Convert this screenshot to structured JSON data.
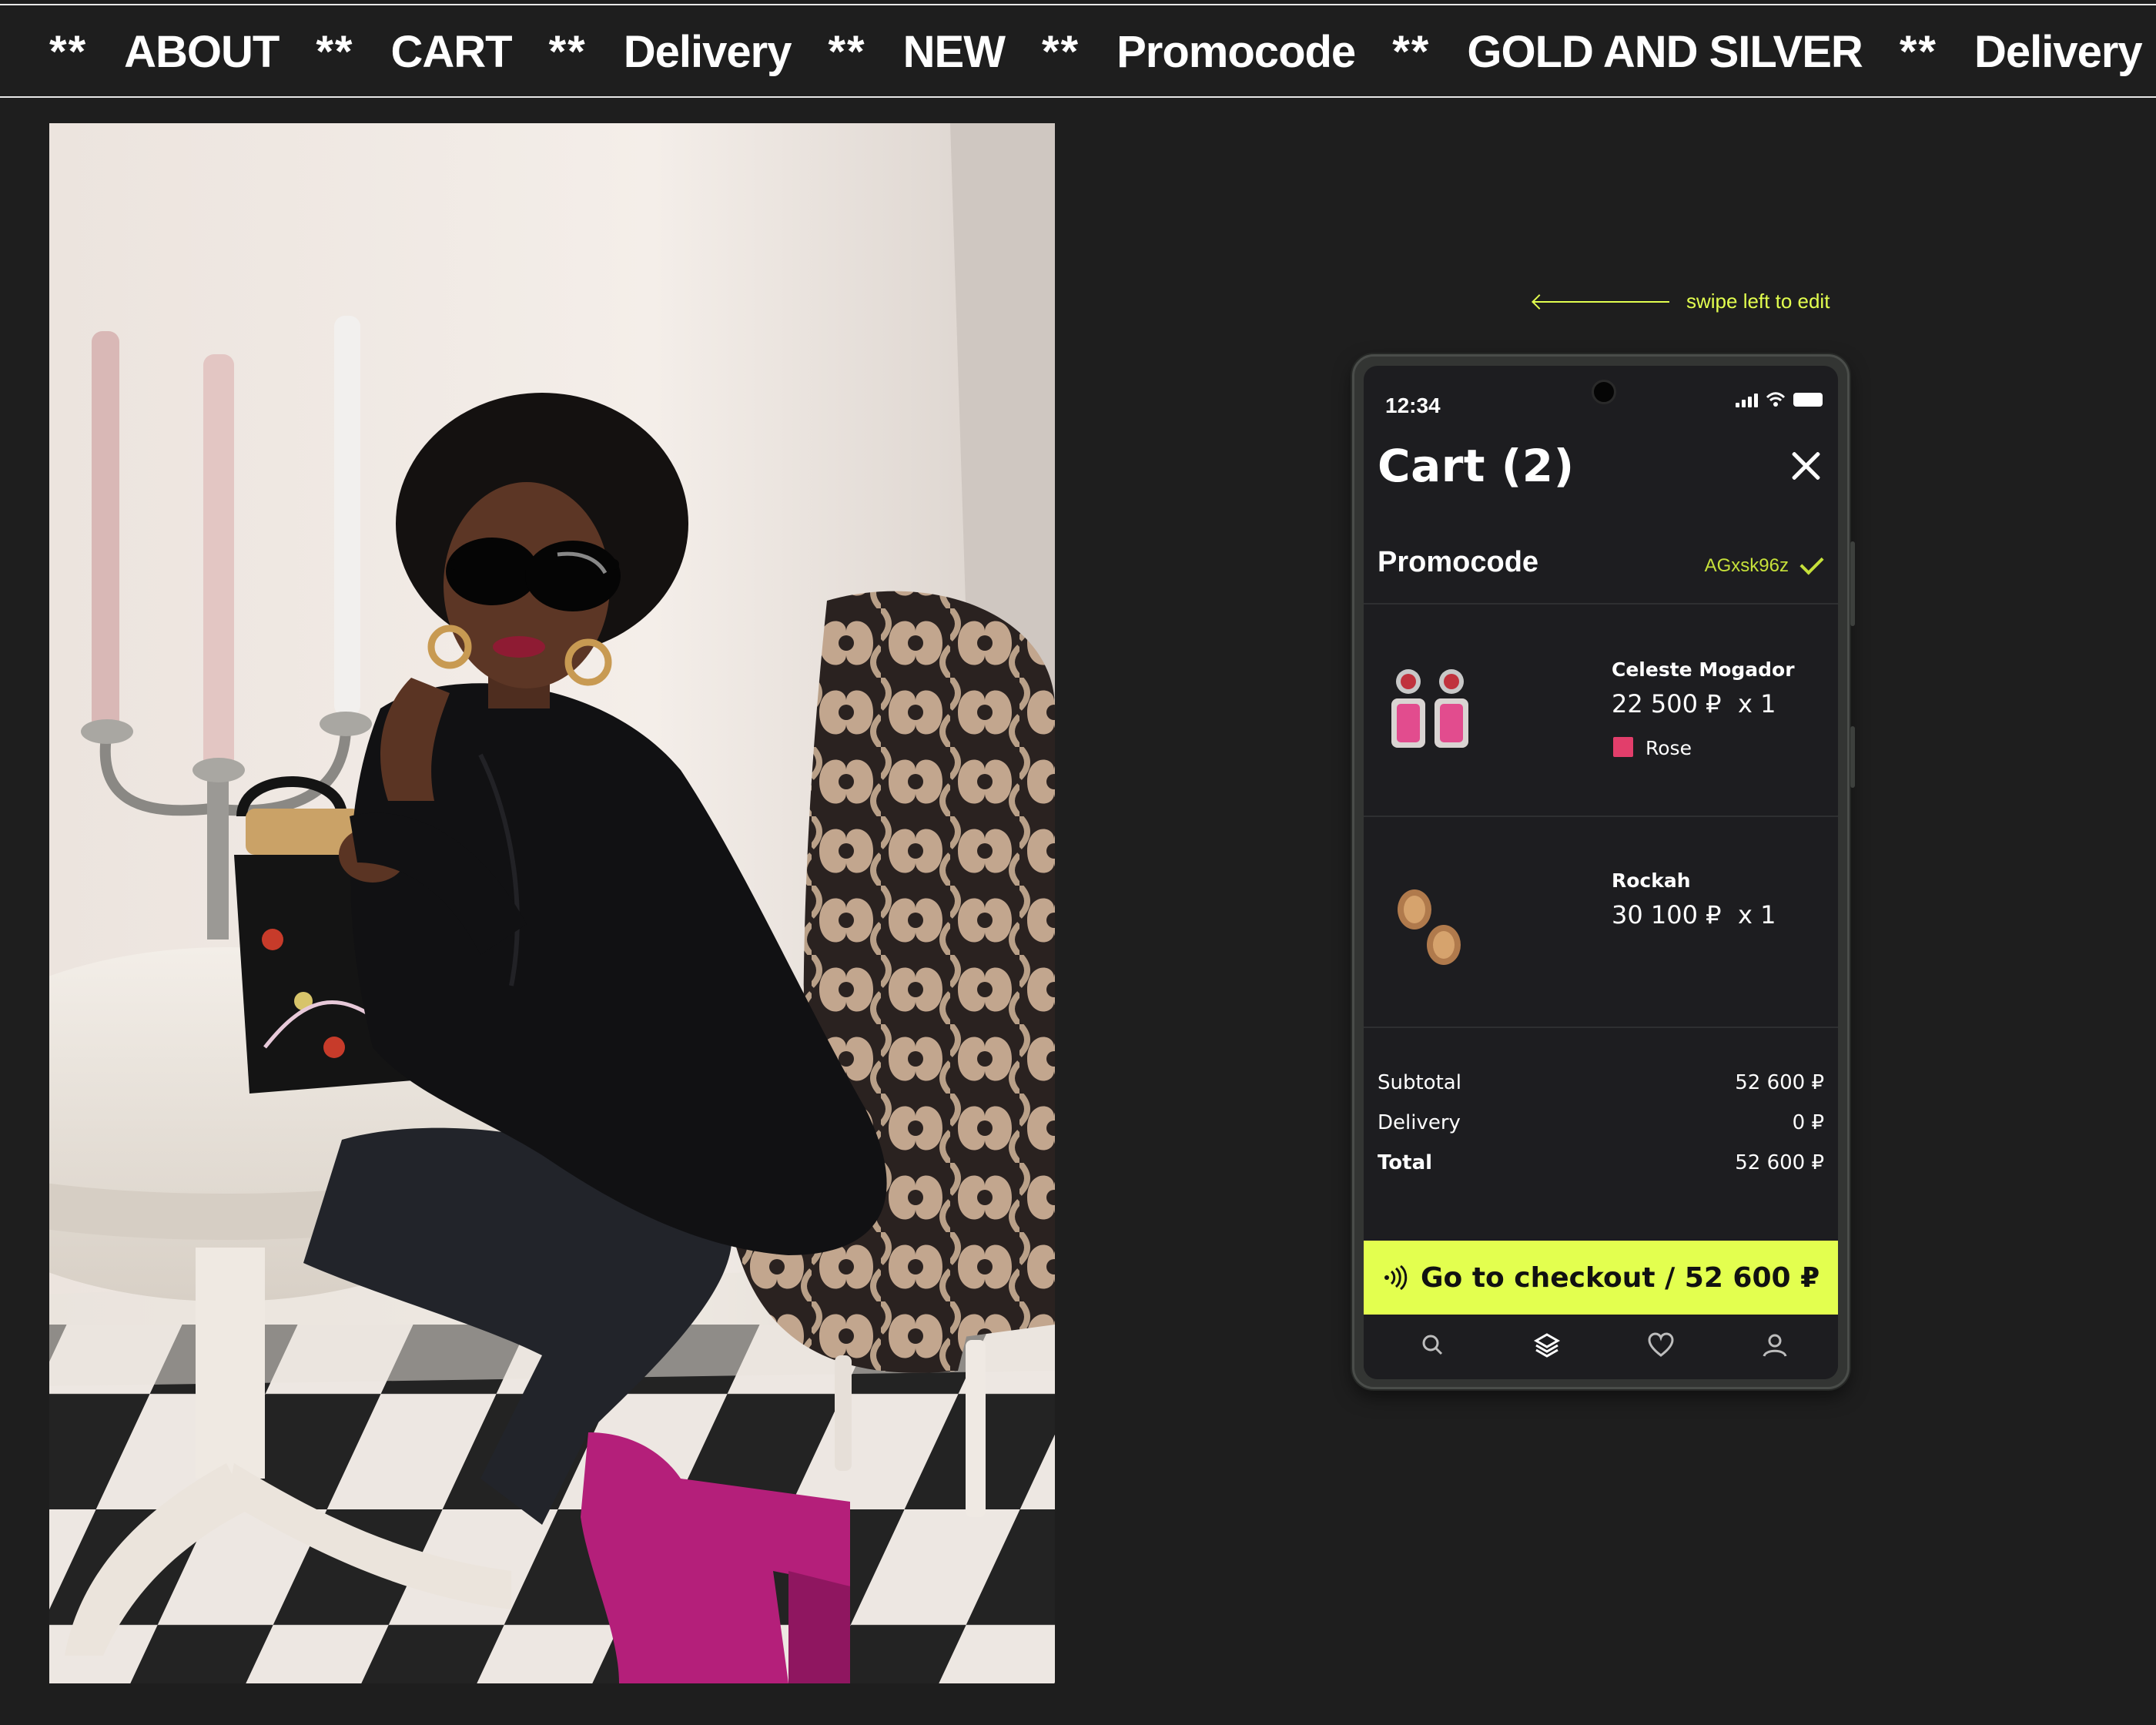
{
  "marquee": {
    "separator": "**",
    "items": [
      "ABOUT",
      "CART",
      "Delivery",
      "NEW",
      "Promocode",
      "GOLD AND SILVER",
      "Delivery"
    ]
  },
  "hint": {
    "text": "swipe left to edit"
  },
  "phone": {
    "status": {
      "time": "12:34"
    },
    "cart": {
      "title": "Cart (2)",
      "promo_label": "Promocode",
      "promo_code": "AGxsk96z",
      "items": [
        {
          "name": "Celeste Mogador",
          "price": "22 500 ₽",
          "qty": "x 1",
          "color_name": "Rose",
          "color_hex": "#e23e6b"
        },
        {
          "name": "Rockah",
          "price": "30 100 ₽",
          "qty": "x 1"
        }
      ],
      "summary": {
        "subtotal_label": "Subtotal",
        "subtotal_value": "52 600 ₽",
        "delivery_label": "Delivery",
        "delivery_value": "0 ₽",
        "total_label": "Total",
        "total_value": "52 600 ₽"
      },
      "checkout_label": "Go to checkout / 52 600 ₽"
    },
    "tabs": [
      "search-icon",
      "layers-icon",
      "heart-icon",
      "profile-icon"
    ]
  },
  "colors": {
    "accent": "#e3ff4f",
    "background": "#1e1e1e",
    "screen": "#1d1d20"
  }
}
